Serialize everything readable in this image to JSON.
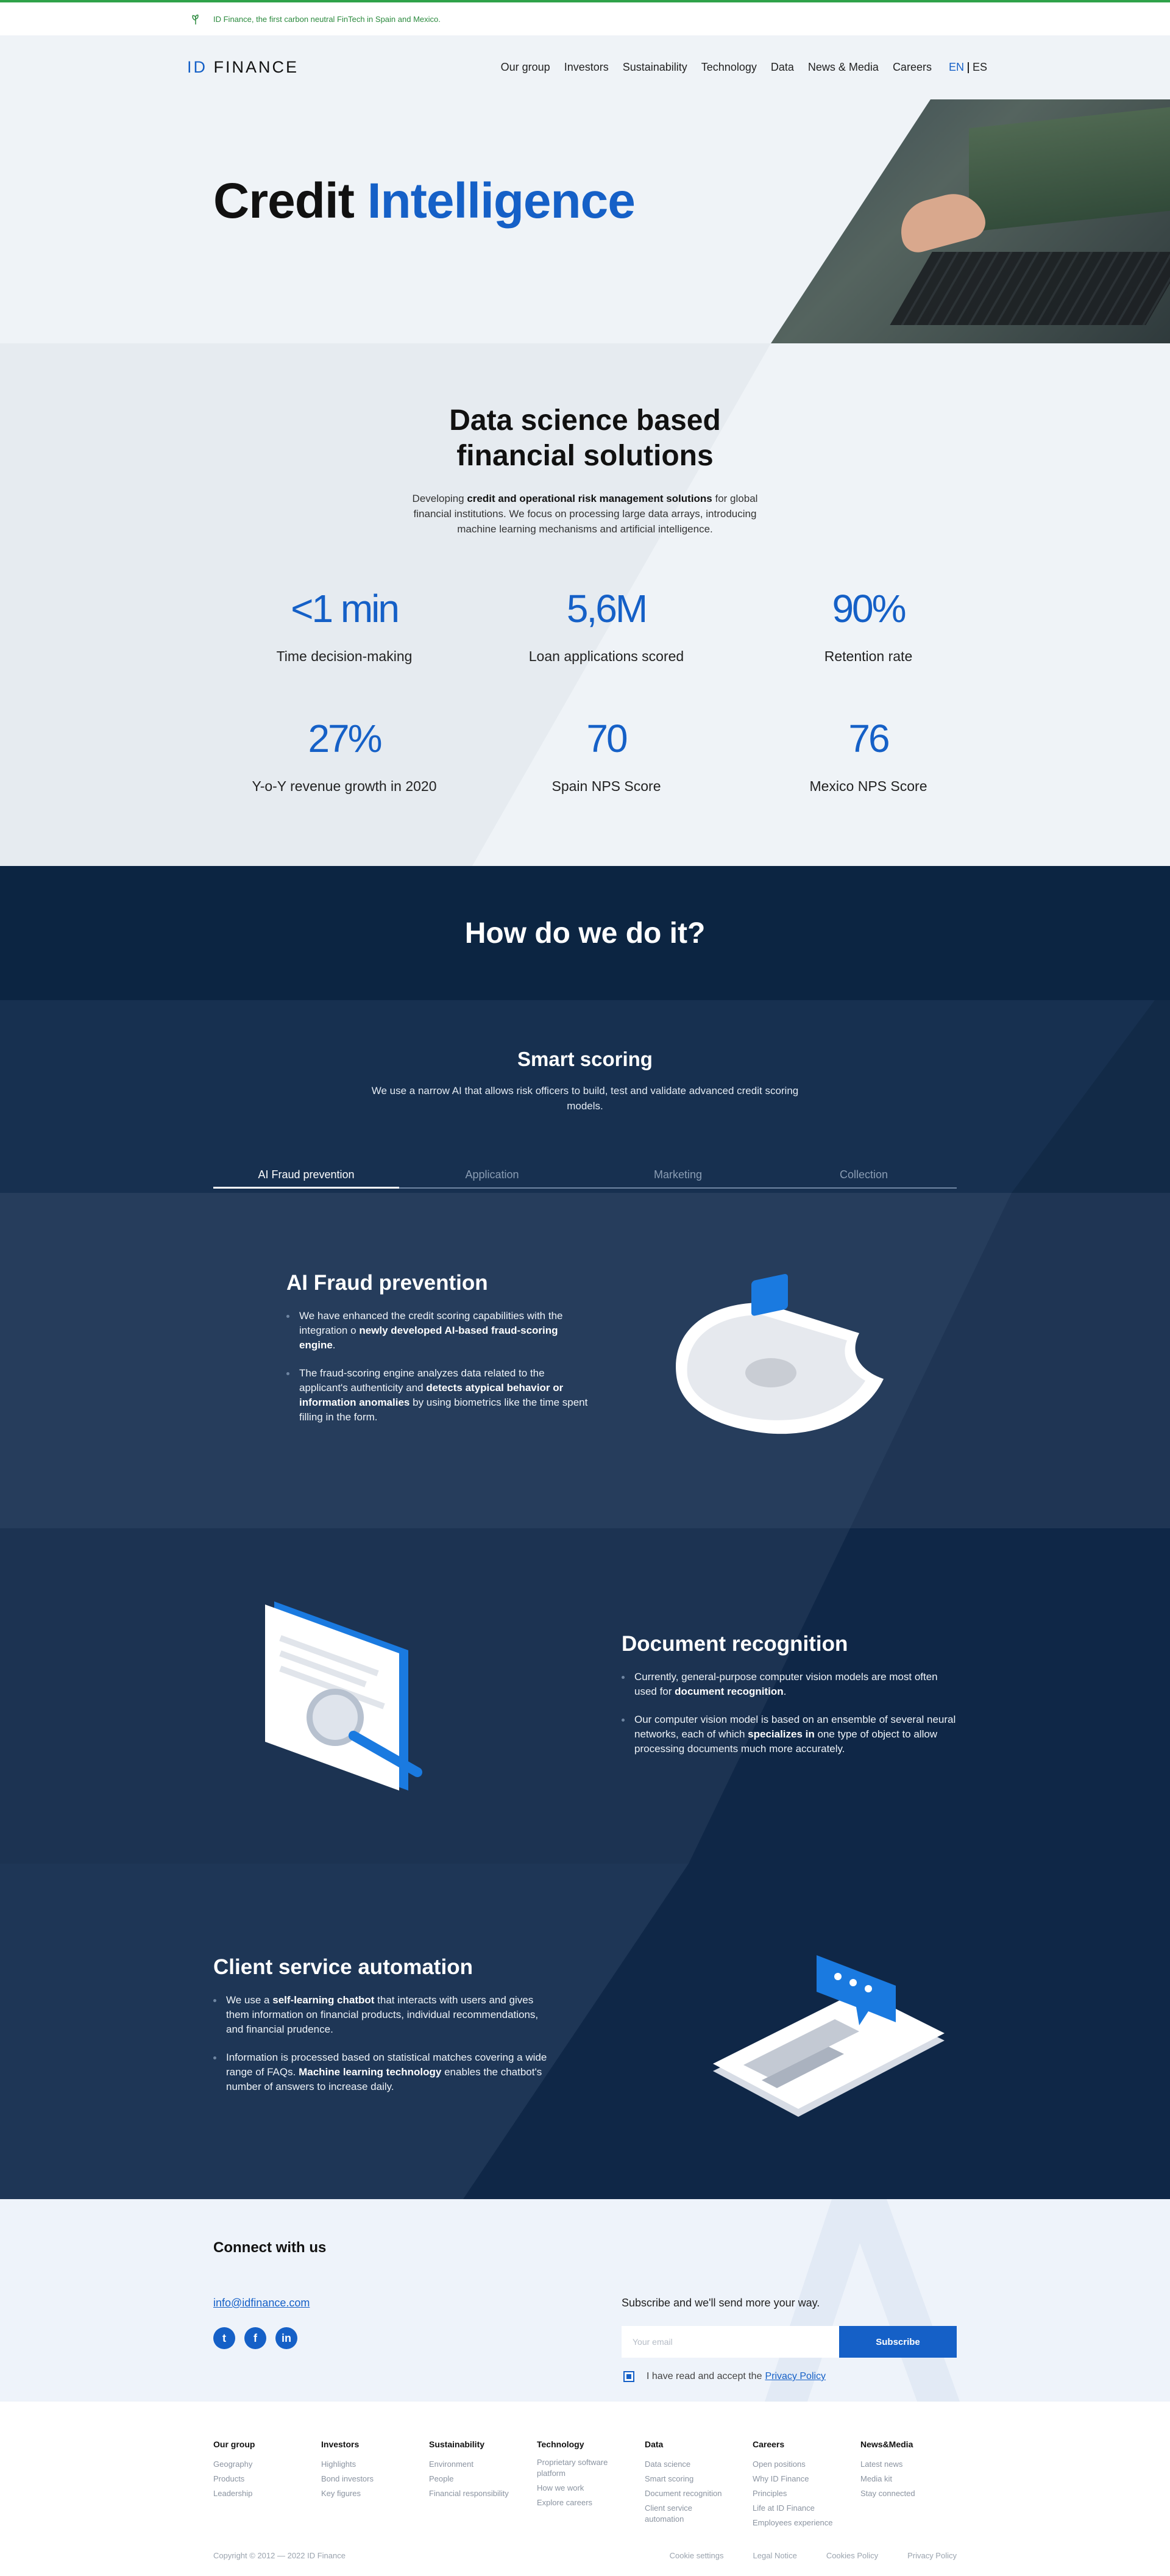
{
  "banner": {
    "text": "ID Finance, the first carbon neutral FinTech in Spain and Mexico."
  },
  "header": {
    "logo_id": "ID",
    "logo_rest": "FINANCE",
    "nav": [
      "Our group",
      "Investors",
      "Sustainability",
      "Technology",
      "Data",
      "News & Media",
      "Careers"
    ],
    "lang_active": "EN",
    "lang_other": "ES"
  },
  "hero": {
    "title_black": "Credit",
    "title_blue": "Intelligence"
  },
  "stats": {
    "heading_line1": "Data science based",
    "heading_line2": "financial solutions",
    "lead_pre": "Developing",
    "lead_bold": "credit and operational risk management solutions",
    "lead_post": "for global financial institutions. We focus on processing large data arrays, introducing machine learning mechanisms and artificial intelligence.",
    "items": [
      {
        "value": "<1 min",
        "label": "Time decision-making"
      },
      {
        "value": "5,6M",
        "label": "Loan applications scored"
      },
      {
        "value": "90%",
        "label": "Retention rate"
      },
      {
        "value": "27%",
        "label": "Y-o-Y revenue growth in 2020"
      },
      {
        "value": "70",
        "label": "Spain NPS Score"
      },
      {
        "value": "76",
        "label": "Mexico NPS Score"
      }
    ]
  },
  "how": {
    "title": "How do we do it?"
  },
  "smart": {
    "title": "Smart scoring",
    "text": "We use a narrow AI that allows risk officers to build, test and validate advanced credit scoring models.",
    "tabs": [
      "AI Fraud prevention",
      "Application",
      "Marketing",
      "Collection"
    ]
  },
  "fraud": {
    "title": "AI Fraud prevention",
    "b1_pre": "We have enhanced the credit scoring capabilities with the integration o",
    "b1_bold": "newly developed AI-based fraud-scoring engine",
    "b1_post": ".",
    "b2_pre": "The fraud-scoring engine analyzes data related to the applicant's authenticity and",
    "b2_bold": "detects atypical behavior or information anomalies",
    "b2_post": "by using biometrics like the time spent filling in the form."
  },
  "docs": {
    "title": "Document recognition",
    "b1_pre": "Currently, general-purpose computer vision models are most often used for",
    "b1_bold": "document recognition",
    "b1_post": ".",
    "b2_pre": "Our computer vision model is based on an ensemble of several neural networks, each of which",
    "b2_bold": "specializes in",
    "b2_post": "one type of object to allow processing documents much more accurately."
  },
  "client": {
    "title": "Client service automation",
    "b1_pre": "We use a",
    "b1_bold": "self-learning chatbot",
    "b1_post": "that interacts with users and gives them information on financial products, individual recommendations, and financial prudence.",
    "b2_pre": "Information is processed based on statistical matches covering a wide range of FAQs.",
    "b2_bold": "Machine learning technology",
    "b2_post": "enables the chatbot's number of answers to increase daily."
  },
  "connect": {
    "title": "Connect with us",
    "email": "info@idfinance.com",
    "social": [
      "t",
      "f",
      "in"
    ],
    "subscribe_title": "Subscribe and we'll send more your way.",
    "email_placeholder": "Your email",
    "subscribe_button": "Subscribe",
    "agree_text": "I have read and accept the",
    "agree_link": "Privacy Policy"
  },
  "footer": {
    "columns": [
      {
        "title": "Our group",
        "links": [
          "Geography",
          "Products",
          "Leadership"
        ]
      },
      {
        "title": "Investors",
        "links": [
          "Highlights",
          "Bond investors",
          "Key figures"
        ]
      },
      {
        "title": "Sustainability",
        "links": [
          "Environment",
          "People",
          "Financial responsibility"
        ]
      },
      {
        "title": "Technology",
        "links": [
          "Proprietary software platform",
          "How we work",
          "Explore careers"
        ]
      },
      {
        "title": "Data",
        "links": [
          "Data science",
          "Smart scoring",
          "Document recognition",
          "Client service automation"
        ]
      },
      {
        "title": "Careers",
        "links": [
          "Open positions",
          "Why ID Finance",
          "Principles",
          "Life at ID Finance",
          "Employees experience"
        ]
      },
      {
        "title": "News&Media",
        "links": [
          "Latest news",
          "Media kit",
          "Stay connected"
        ]
      }
    ],
    "copyright": "Copyright © 2012 — 2022 ID Finance",
    "legal": [
      "Cookie settings",
      "Legal Notice",
      "Cookies Policy",
      "Privacy Policy"
    ]
  },
  "colors": {
    "brand_blue": "#1560c7",
    "navy": "#0c2542",
    "green": "#2fa24a"
  }
}
